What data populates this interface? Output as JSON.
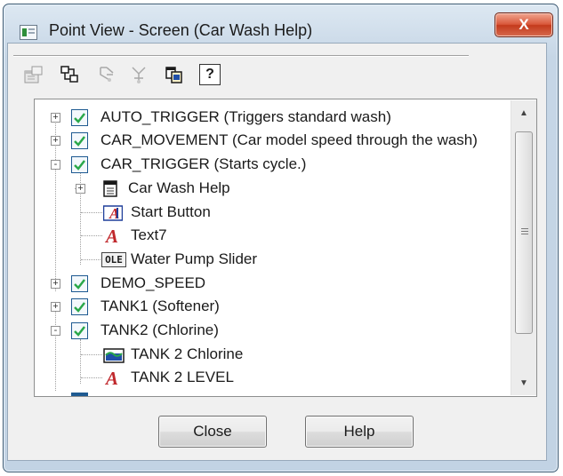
{
  "window": {
    "title": "Point View - Screen (Car Wash Help)",
    "close_glyph": "X"
  },
  "toolbar": {
    "buttons": [
      {
        "icon": "properties-icon",
        "enabled": false
      },
      {
        "icon": "tree-view-icon",
        "enabled": true
      },
      {
        "icon": "expand-tree-icon",
        "enabled": false
      },
      {
        "icon": "collapse-tree-icon",
        "enabled": false
      },
      {
        "icon": "copy-icon",
        "enabled": true
      },
      {
        "icon": "help-icon",
        "enabled": true,
        "glyph": "?"
      }
    ]
  },
  "tree": {
    "items": [
      {
        "label": "AUTO_TRIGGER (Triggers standard wash)",
        "level": 0,
        "type": "point",
        "expander": "+"
      },
      {
        "label": "CAR_MOVEMENT (Car model speed through the wash)",
        "level": 0,
        "type": "point",
        "expander": "+"
      },
      {
        "label": "CAR_TRIGGER (Starts cycle.)",
        "level": 0,
        "type": "point",
        "expander": "-"
      },
      {
        "label": "Car Wash Help",
        "level": 1,
        "type": "screen",
        "expander": "+"
      },
      {
        "label": "Start Button",
        "level": 1,
        "type": "text-button",
        "expander": ""
      },
      {
        "label": "Text7",
        "level": 1,
        "type": "text",
        "expander": ""
      },
      {
        "label": "Water Pump Slider",
        "level": 1,
        "type": "ole",
        "expander": "",
        "badge": "OLE"
      },
      {
        "label": "DEMO_SPEED",
        "level": 0,
        "type": "point",
        "expander": "+"
      },
      {
        "label": "TANK1 (Softener)",
        "level": 0,
        "type": "point",
        "expander": "+"
      },
      {
        "label": "TANK2 (Chlorine)",
        "level": 0,
        "type": "point",
        "expander": "-"
      },
      {
        "label": "TANK 2 Chlorine",
        "level": 1,
        "type": "tank",
        "expander": ""
      },
      {
        "label": "TANK 2 LEVEL",
        "level": 1,
        "type": "text",
        "expander": ""
      }
    ]
  },
  "buttons": {
    "close_label": "Close",
    "help_label": "Help"
  },
  "colors": {
    "checkbox_border": "#1e5a91",
    "check_mark": "#2aa84a",
    "text_icon_red": "#c0282c",
    "close_button": "#c8452a"
  }
}
